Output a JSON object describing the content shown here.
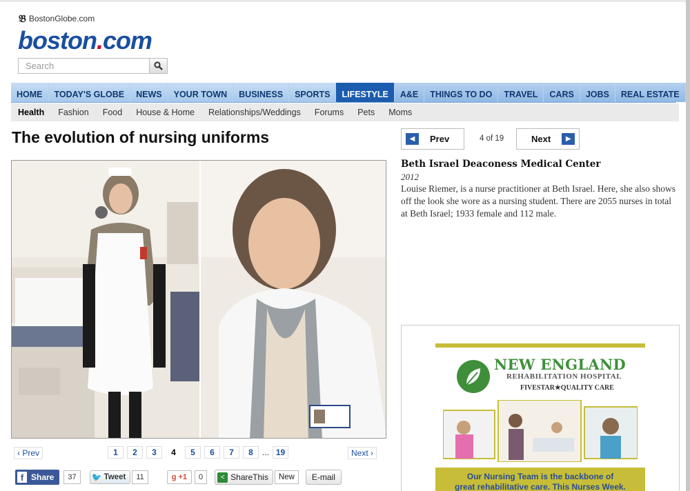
{
  "header": {
    "globe_link": "BostonGlobe.com",
    "logo_text": "boston",
    "logo_dot": ".",
    "logo_suffix": "com",
    "search_placeholder": "Search"
  },
  "main_nav": [
    "HOME",
    "TODAY'S GLOBE",
    "NEWS",
    "YOUR TOWN",
    "BUSINESS",
    "SPORTS",
    "LIFESTYLE",
    "A&E",
    "THINGS TO DO",
    "TRAVEL",
    "CARS",
    "JOBS",
    "REAL ESTATE"
  ],
  "main_nav_active": "LIFESTYLE",
  "sub_nav": [
    "Health",
    "Fashion",
    "Food",
    "House & Home",
    "Relationships/Weddings",
    "Forums",
    "Pets",
    "Moms"
  ],
  "sub_nav_active": "Health",
  "article": {
    "title": "The evolution of nursing uniforms"
  },
  "gallery": {
    "prev_label": "Prev",
    "next_label": "Next",
    "counter": "4 of 19",
    "pager_prev": "‹ Prev",
    "pager_next": "Next ›",
    "pages": [
      "1",
      "2",
      "3",
      "4",
      "5",
      "6",
      "7",
      "8"
    ],
    "current_page": "4",
    "ellipsis": "...",
    "last_page": "19"
  },
  "caption": {
    "title": "Beth Israel Deaconess Medical Center",
    "year": "2012",
    "text": "Louise Riemer, is a nurse practitioner at Beth Israel. Here, she also shows off the look she wore as a nursing student. There are 2055 nurses in total at Beth Israel; 1933 female and 112 male."
  },
  "share": {
    "facebook_label": "Share",
    "facebook_count": "37",
    "tweet_label": "Tweet",
    "tweet_count": "11",
    "gplus_label": "+1",
    "gplus_count": "0",
    "sharethis_label": "ShareThis",
    "new_label": "New",
    "email_label": "E-mail"
  },
  "ad": {
    "name": "NEW ENGLAND",
    "subtitle": "REHABILITATION HOSPITAL",
    "rating": "FIVESTAR★QUALITY CARE",
    "tagline_1": "Our Nursing Team is the backbone of",
    "tagline_2": "great rehabilitative care. This Nurses Week."
  },
  "colors": {
    "brand_blue": "#1a4fa0",
    "nav_active": "#1c5cae",
    "ad_green": "#3f8f3a",
    "ad_gold": "#c7bd38"
  }
}
